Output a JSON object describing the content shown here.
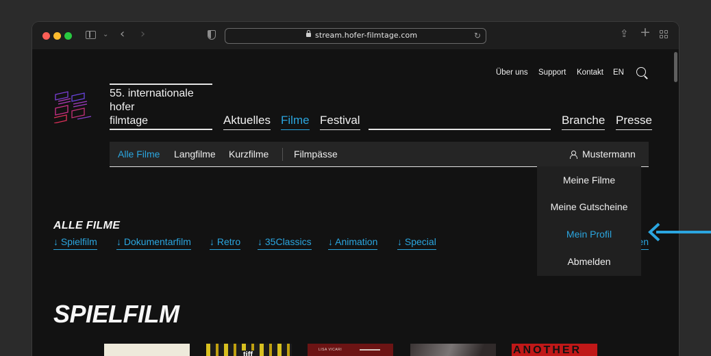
{
  "browser": {
    "url": "stream.hofer-filmtage.com",
    "colors": {
      "red": "#fe5f57",
      "yellow": "#febc2e",
      "green": "#28c840"
    }
  },
  "utility_nav": [
    "Über uns",
    "Support",
    "Kontakt",
    "EN"
  ],
  "brand": {
    "line1": "55. internationale",
    "line2": "hofer",
    "line3": "filmtage"
  },
  "main_nav": [
    {
      "label": "Aktuelles",
      "active": false
    },
    {
      "label": "Filme",
      "active": true
    },
    {
      "label": "Festival",
      "active": false
    },
    {
      "label": "Branche",
      "active": false
    },
    {
      "label": "Presse",
      "active": false
    }
  ],
  "sub_nav": [
    {
      "label": "Alle Filme",
      "active": true
    },
    {
      "label": "Langfilme",
      "active": false
    },
    {
      "label": "Kurzfilme",
      "active": false
    },
    {
      "label": "Filmpässe",
      "active": false
    }
  ],
  "user": {
    "name": "Mustermann"
  },
  "user_menu": [
    {
      "label": "Meine Filme",
      "active": false
    },
    {
      "label": "Meine Gutscheine",
      "active": false
    },
    {
      "label": "Mein Profil",
      "active": true
    },
    {
      "label": "Abmelden",
      "active": false
    }
  ],
  "all_films": {
    "title": "ALLE FILME",
    "anchors": [
      "↓ Spielfilm",
      "↓ Dokumentarfilm",
      "↓ Retro",
      "↓ 35Classics",
      "↓ Animation",
      "↓ Special"
    ],
    "clipped_anchor": "en"
  },
  "spielfilm": {
    "title": "SPIELFILM",
    "posters": [
      "",
      "tiff",
      "LISA VICARI",
      "",
      "ANOTHER"
    ]
  },
  "accent_color": "#2ba6e0"
}
